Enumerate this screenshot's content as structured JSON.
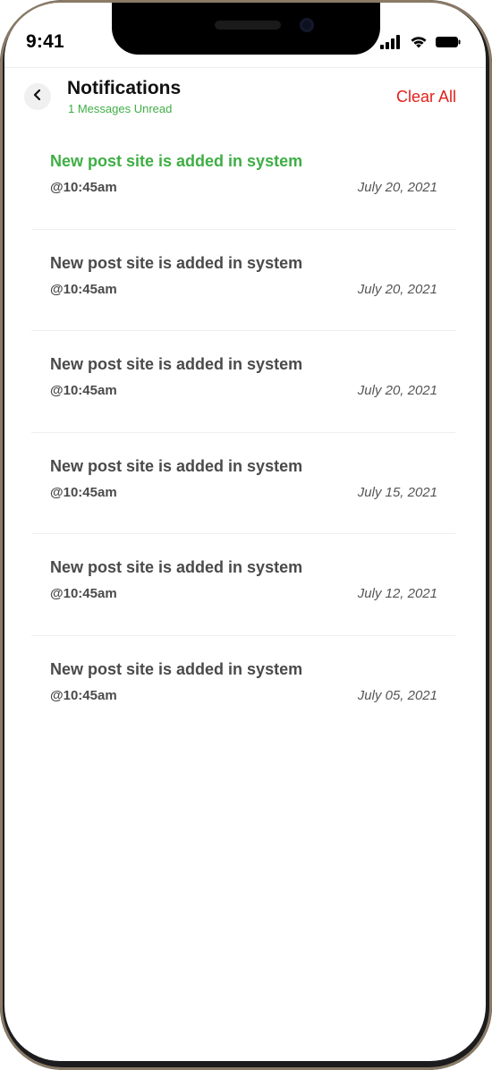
{
  "status_bar": {
    "time": "9:41",
    "icons": [
      "signal-icon",
      "wifi-icon",
      "battery-icon"
    ]
  },
  "header": {
    "back_icon": "chevron-left-icon",
    "title": "Notifications",
    "subtitle": "1 Messages Unread",
    "clear_all_label": "Clear All"
  },
  "colors": {
    "unread": "#3fae45",
    "clear_all": "#e2211c",
    "text": "#4a4a4a"
  },
  "notifications": [
    {
      "title": "New post site is added in system",
      "time": "@10:45am",
      "date": "July 20, 2021",
      "unread": true
    },
    {
      "title": "New post site is added in system",
      "time": "@10:45am",
      "date": "July 20, 2021",
      "unread": false
    },
    {
      "title": "New post site is added in system",
      "time": "@10:45am",
      "date": "July 20, 2021",
      "unread": false
    },
    {
      "title": "New post site is added in system",
      "time": "@10:45am",
      "date": "July 15, 2021",
      "unread": false
    },
    {
      "title": "New post site is added in system",
      "time": "@10:45am",
      "date": "July 12, 2021",
      "unread": false
    },
    {
      "title": "New post site is added in system",
      "time": "@10:45am",
      "date": "July 05, 2021",
      "unread": false
    }
  ]
}
